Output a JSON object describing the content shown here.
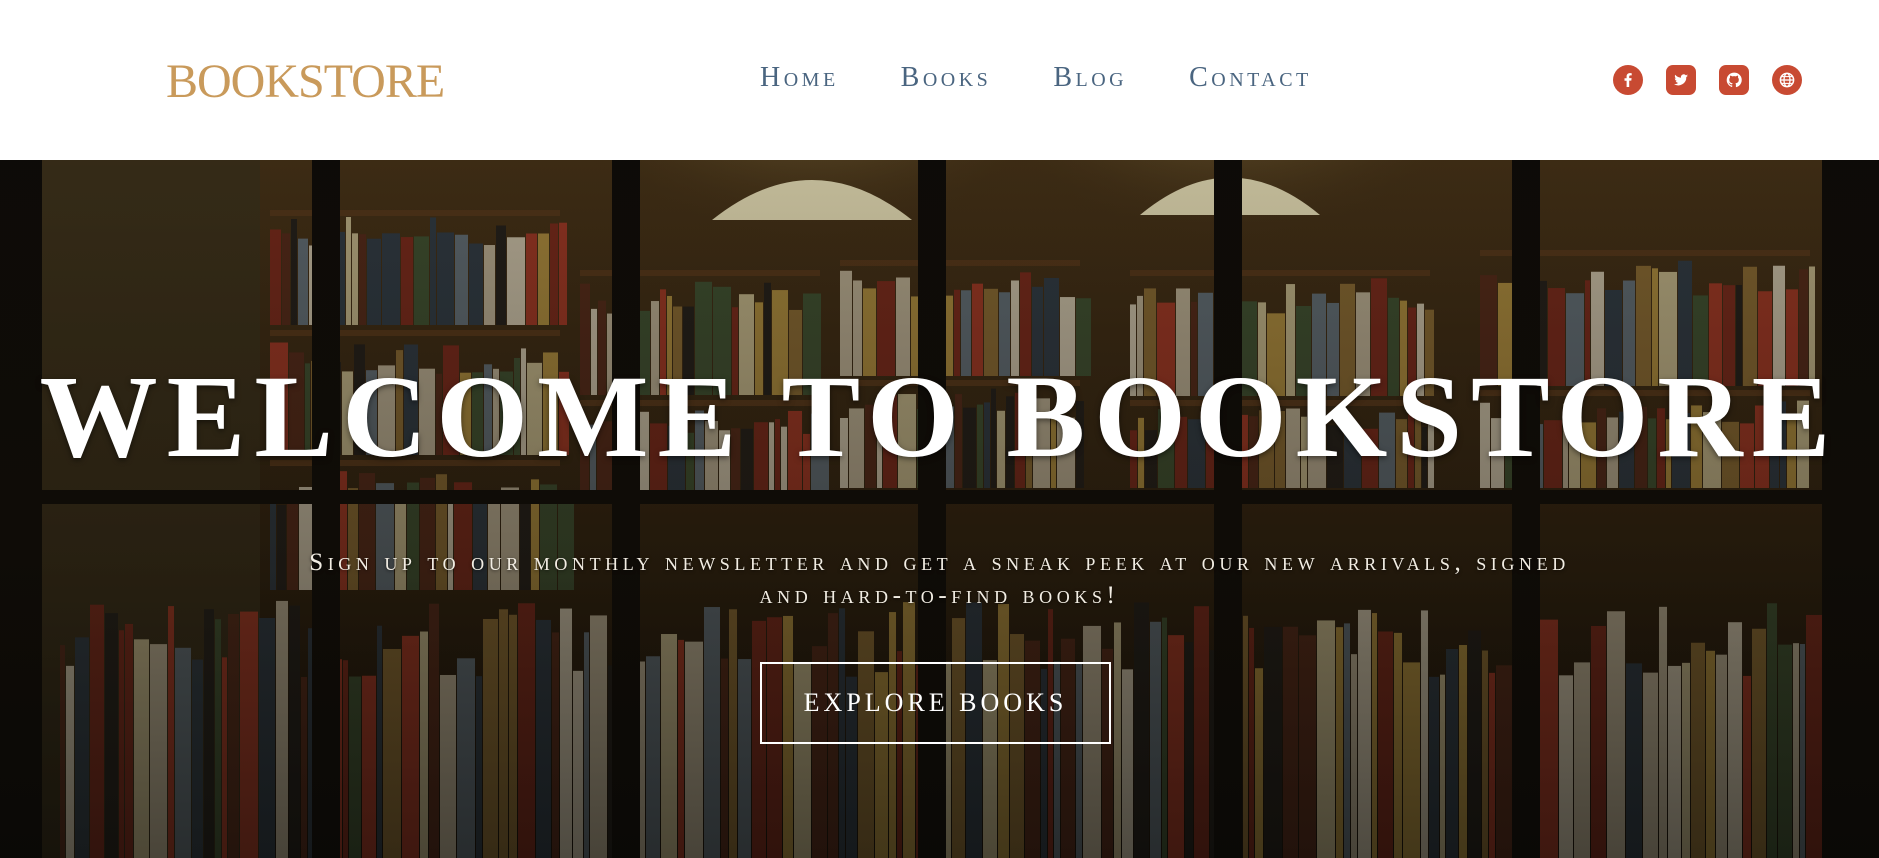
{
  "header": {
    "logo": "BOOKSTORE",
    "nav": [
      "Home",
      "Books",
      "Blog",
      "Contact"
    ],
    "social_icons": [
      "facebook-icon",
      "twitter-icon",
      "github-icon",
      "globe-icon"
    ],
    "accent_color": "#c84a32",
    "logo_color": "#c99a5b",
    "nav_color": "#4a6580"
  },
  "hero": {
    "title": "WELCOME TO BOOKSTORE",
    "subtitle": "Sign up to our monthly newsletter and get a sneak peek at our new arrivals, signed and hard-to-find books!",
    "button_label": "EXPLORE BOOKS",
    "background": "bookstore-window-photo"
  }
}
